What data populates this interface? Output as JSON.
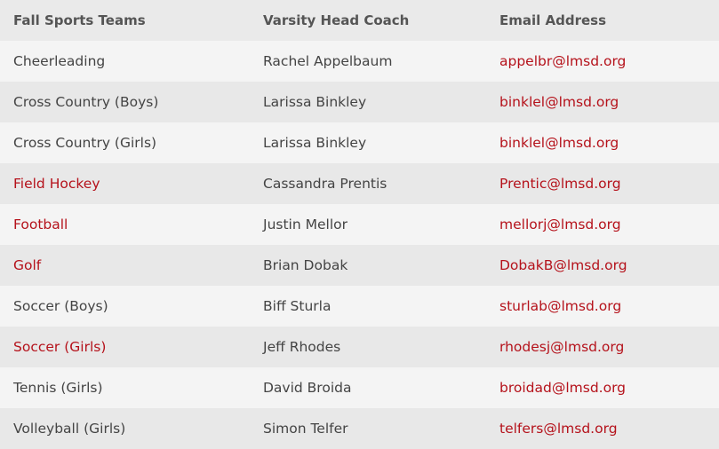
{
  "table": {
    "headers": {
      "sport": "Fall Sports Teams",
      "coach": "Varsity Head Coach",
      "email": "Email Address"
    },
    "rows": [
      {
        "sport": "Cheerleading",
        "sport_link": false,
        "coach": "Rachel Appelbaum",
        "email": "appelbr@lmsd.org"
      },
      {
        "sport": "Cross Country (Boys)",
        "sport_link": false,
        "coach": "Larissa Binkley",
        "email": "binklel@lmsd.org"
      },
      {
        "sport": "Cross Country (Girls)",
        "sport_link": false,
        "coach": "Larissa Binkley",
        "email": "binklel@lmsd.org"
      },
      {
        "sport": "Field Hockey",
        "sport_link": true,
        "coach": "Cassandra Prentis",
        "email": "Prentic@lmsd.org"
      },
      {
        "sport": "Football",
        "sport_link": true,
        "coach": "Justin Mellor",
        "email": "mellorj@lmsd.org"
      },
      {
        "sport": "Golf",
        "sport_link": true,
        "coach": "Brian Dobak",
        "email": "DobakB@lmsd.org"
      },
      {
        "sport": "Soccer (Boys)",
        "sport_link": false,
        "coach": "Biff Sturla",
        "email": "sturlab@lmsd.org"
      },
      {
        "sport": "Soccer (Girls)",
        "sport_link": true,
        "coach": "Jeff Rhodes",
        "email": "rhodesj@lmsd.org"
      },
      {
        "sport": "Tennis (Girls)",
        "sport_link": false,
        "coach": "David Broida",
        "email": "broidad@lmsd.org"
      },
      {
        "sport": "Volleyball (Girls)",
        "sport_link": false,
        "coach": "Simon Telfer",
        "email": "telfers@lmsd.org"
      }
    ]
  },
  "colors": {
    "link": "#b5121b",
    "text": "#444444",
    "header_text": "#555555",
    "row_light": "#f4f4f4",
    "row_dark": "#e8e8e8"
  }
}
